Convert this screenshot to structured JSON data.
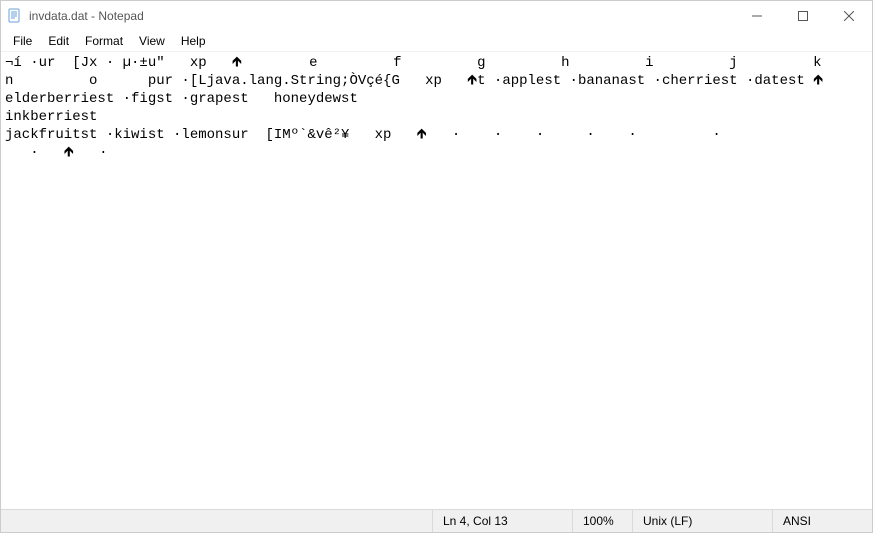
{
  "titlebar": {
    "title": "invdata.dat - Notepad"
  },
  "menu": {
    "file": "File",
    "edit": "Edit",
    "format": "Format",
    "view": "View",
    "help": "Help"
  },
  "content": {
    "line1": "¬í ·ur  [Jx · µ·±u\"   xp   🡹        e         f         g         h         i         j         k         l         m         ",
    "line2": "n         o      pur ·[Ljava.lang.String;­ÒVçé{G   xp   🡹t ·applest ·bananast ·cherriest ·datest 🡹",
    "line3": "elderberriest ·figst ·grapest   honeydewst ",
    "line4": "inkberriest ",
    "line5": "jackfruitst ·kiwist ·lemonsur  [IMº`&vê²¥   xp   🡹   ·    ·    ·     ·    ·         ·",
    "line6": "   ·   🡹   ·"
  },
  "status": {
    "lncol": "Ln 4, Col 13",
    "zoom": "100%",
    "eol": "Unix (LF)",
    "encoding": "ANSI"
  }
}
